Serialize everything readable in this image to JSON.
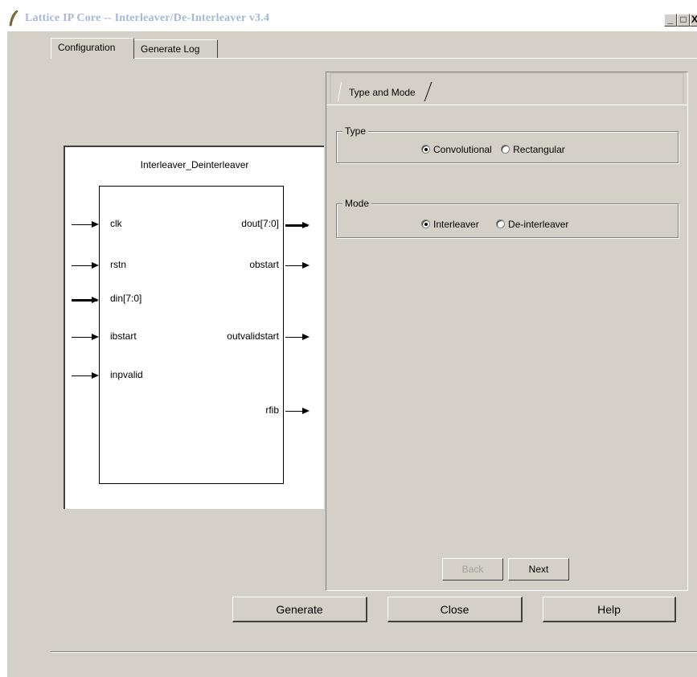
{
  "window": {
    "title": "Lattice IP Core -- Interleaver/De-Interleaver v3.4",
    "controls": {
      "minimize": "_",
      "maximize": "□",
      "close": "X"
    }
  },
  "tabs": [
    {
      "label": "Configuration",
      "active": true
    },
    {
      "label": "Generate Log",
      "active": false
    }
  ],
  "diagram": {
    "title": "Interleaver_Deinterleaver",
    "inputs": [
      "clk",
      "rstn",
      "din[7:0]",
      "ibstart",
      "inpvalid"
    ],
    "outputs": [
      "dout[7:0]",
      "obstart",
      "outvalidstart",
      "rfib"
    ]
  },
  "panel": {
    "tab_label": "Type and Mode",
    "type_group": {
      "legend": "Type",
      "options": [
        "Convolutional",
        "Rectangular"
      ],
      "selected": "Convolutional"
    },
    "mode_group": {
      "legend": "Mode",
      "options": [
        "Interleaver",
        "De-interleaver"
      ],
      "selected": "Interleaver"
    },
    "back_label": "Back",
    "next_label": "Next"
  },
  "footer": {
    "generate_label": "Generate",
    "close_label": "Close",
    "help_label": "Help"
  }
}
